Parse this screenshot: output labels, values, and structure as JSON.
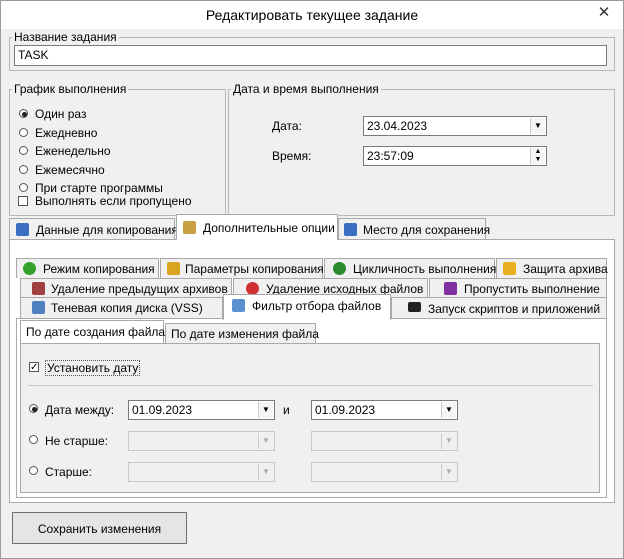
{
  "window": {
    "title": "Редактировать текущее задание",
    "close_glyph": "✕"
  },
  "task": {
    "label": "Название задания",
    "value": "TASK"
  },
  "schedule": {
    "label": "График выполнения",
    "options": [
      "Один раз",
      "Ежедневно",
      "Еженедельно",
      "Ежемесячно",
      "При старте программы"
    ],
    "selected_index": 0,
    "missed_label": "Выполнять если пропущено"
  },
  "datetime": {
    "label": "Дата и время выполнения",
    "date_label": "Дата:",
    "date_value": "23.04.2023",
    "time_label": "Время:",
    "time_value": "23:57:09"
  },
  "main_tabs": [
    {
      "label": "Данные для копирования",
      "icon": "data-icon",
      "color": "#3a6fc4"
    },
    {
      "label": "Дополнительные опции",
      "icon": "options-icon",
      "color": "#c8a040"
    },
    {
      "label": "Место для сохранения",
      "icon": "save-location-icon",
      "color": "#3a6fc4"
    }
  ],
  "sub_tabs_row1": [
    {
      "label": "Режим копирования",
      "icon": "plus-icon",
      "color": "#35a02c"
    },
    {
      "label": "Параметры копирования",
      "icon": "params-icon",
      "color": "#d9a521"
    },
    {
      "label": "Цикличность выполнения",
      "icon": "cycle-icon",
      "color": "#2c8a2c"
    },
    {
      "label": "Защита архива",
      "icon": "lock-icon",
      "color": "#e8b020"
    }
  ],
  "sub_tabs_row2": [
    {
      "label": "Удаление предыдущих архивов",
      "icon": "archive-delete-icon",
      "color": "#a04040"
    },
    {
      "label": "Удаление исходных файлов",
      "icon": "delete-icon",
      "color": "#d03030"
    },
    {
      "label": "Пропустить выполнение",
      "icon": "skip-icon",
      "color": "#8030a0"
    }
  ],
  "sub_tabs_row3": [
    {
      "label": "Теневая копия диска (VSS)",
      "icon": "vss-icon",
      "color": "#5080c0"
    },
    {
      "label": "Фильтр отбора файлов",
      "icon": "filter-icon",
      "color": "#5a8fd0"
    },
    {
      "label": "Запуск скриптов и приложений",
      "icon": "terminal-icon",
      "color": "#222222"
    }
  ],
  "filter_tabs": [
    "По дате создания файла",
    "По дате изменения файла"
  ],
  "filter": {
    "set_date_label": "Установить дату",
    "between_label": "Дата между:",
    "between_from": "01.09.2023",
    "and_label": "и",
    "between_to": "01.09.2023",
    "not_older_label": "Не старше:",
    "older_label": "Старше:"
  },
  "save_button": "Сохранить изменения"
}
